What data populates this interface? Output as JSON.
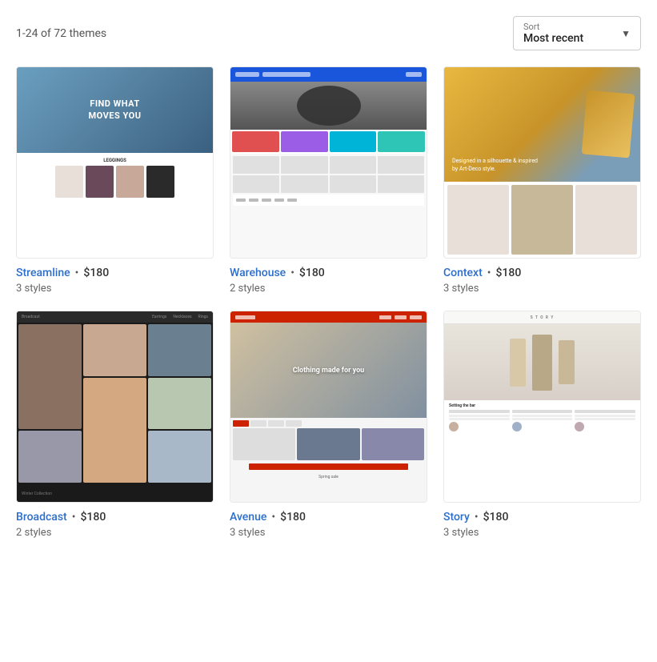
{
  "header": {
    "themes_count": "1-24 of 72 themes",
    "sort_label": "Sort",
    "sort_value": "Most recent"
  },
  "themes": [
    {
      "id": "streamline",
      "name": "Streamline",
      "price": "$180",
      "styles_count": "3 styles",
      "thumb_type": "streamline"
    },
    {
      "id": "warehouse",
      "name": "Warehouse",
      "price": "$180",
      "styles_count": "2 styles",
      "thumb_type": "warehouse"
    },
    {
      "id": "context",
      "name": "Context",
      "price": "$180",
      "styles_count": "3 styles",
      "thumb_type": "context"
    },
    {
      "id": "broadcast",
      "name": "Broadcast",
      "price": "$180",
      "styles_count": "2 styles",
      "thumb_type": "broadcast"
    },
    {
      "id": "avenue",
      "name": "Avenue",
      "price": "$180",
      "styles_count": "3 styles",
      "thumb_type": "avenue"
    },
    {
      "id": "story",
      "name": "Story",
      "price": "$180",
      "styles_count": "3 styles",
      "thumb_type": "story"
    }
  ],
  "separator": "•"
}
